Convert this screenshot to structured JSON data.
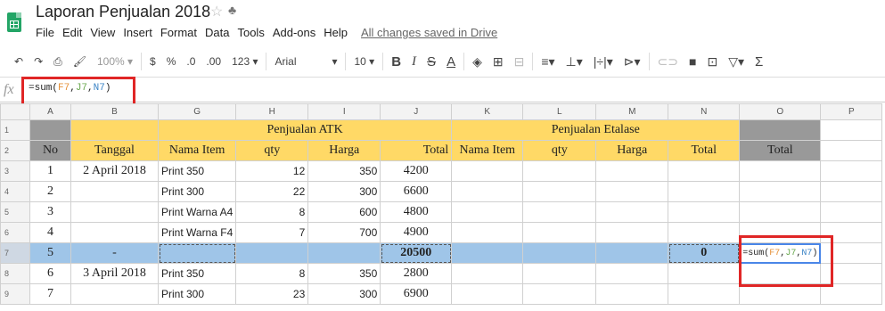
{
  "doc": {
    "title": "Laporan Penjualan 2018",
    "star_icon": "star-icon",
    "share_icon": "folder-icon"
  },
  "menu": [
    "File",
    "Edit",
    "View",
    "Insert",
    "Format",
    "Data",
    "Tools",
    "Add-ons",
    "Help"
  ],
  "saved_status": "All changes saved in Drive",
  "toolbar": {
    "zoom": "100%",
    "currency": "$",
    "percent": "%",
    "dec_less": ".0",
    "dec_more": ".00",
    "more_formats": "123",
    "font": "Arial",
    "size": "10",
    "bold": "B",
    "italic": "I",
    "strike": "S",
    "text_color": "A"
  },
  "formula_bar": {
    "fx": "fx",
    "prefix": "=sum(",
    "ref1": "F7",
    "sep1": ",",
    "ref2": "J7",
    "sep2": ",",
    "ref3": "N7",
    "suffix": ")"
  },
  "columns": [
    "A",
    "B",
    "G",
    "H",
    "I",
    "J",
    "K",
    "L",
    "M",
    "N",
    "O",
    "P"
  ],
  "rows": [
    "1",
    "2",
    "3",
    "4",
    "5",
    "6",
    "7",
    "8",
    "9"
  ],
  "headers": {
    "no": "No",
    "tanggal": "Tanggal",
    "atk_group": "Penjualan ATK",
    "etalase_group": "Penjualan Etalase",
    "nama_item": "Nama Item",
    "qty": "qty",
    "harga": "Harga",
    "total": "Total",
    "grand_total": "Total"
  },
  "data_rows": [
    {
      "no": "1",
      "tanggal": "2 April 2018",
      "item": "Print 350",
      "qty": "12",
      "harga": "350",
      "total": "4200"
    },
    {
      "no": "2",
      "tanggal": "",
      "item": "Print 300",
      "qty": "22",
      "harga": "300",
      "total": "6600"
    },
    {
      "no": "3",
      "tanggal": "",
      "item": "Print Warna A4",
      "qty": "8",
      "harga": "600",
      "total": "4800"
    },
    {
      "no": "4",
      "tanggal": "",
      "item": "Print Warna F4",
      "qty": "7",
      "harga": "700",
      "total": "4900"
    },
    {
      "no": "5",
      "tanggal": "-",
      "item": "",
      "qty": "",
      "harga": "",
      "total": "20500",
      "etalase_total": "0"
    },
    {
      "no": "6",
      "tanggal": "3 April 2018",
      "item": "Print 350",
      "qty": "8",
      "harga": "350",
      "total": "2800"
    },
    {
      "no": "7",
      "tanggal": "",
      "item": "Print 300",
      "qty": "23",
      "harga": "300",
      "total": "6900"
    }
  ],
  "colors": {
    "header_yellow": "#ffd966",
    "grand_total_gray": "#999999",
    "selected_row": "#9fc5e8",
    "highlight_red": "#e02626"
  }
}
